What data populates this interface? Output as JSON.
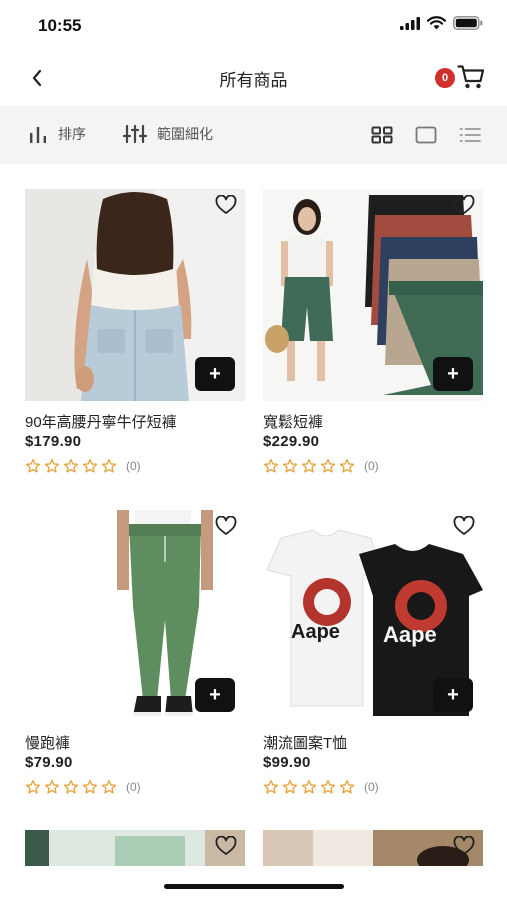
{
  "status": {
    "time": "10:55"
  },
  "nav": {
    "title": "所有商品",
    "cart_count": "0"
  },
  "filters": {
    "sort_label": "排序",
    "refine_label": "範圍細化"
  },
  "products": [
    {
      "name": "90年高腰丹寧牛仔短褲",
      "price": "$179.90",
      "rating_count": "(0)"
    },
    {
      "name": "寬鬆短褲",
      "price": "$229.90",
      "rating_count": "(0)"
    },
    {
      "name": "慢跑褲",
      "price": "$79.90",
      "rating_count": "(0)"
    },
    {
      "name": "潮流圖案T恤",
      "price": "$99.90",
      "rating_count": "(0)"
    }
  ],
  "product_image_text": {
    "tee_brand": "Aape"
  },
  "colors": {
    "accent": "#d2312b",
    "star": "#e8a33d",
    "filter_bg": "#f4f4f4"
  }
}
